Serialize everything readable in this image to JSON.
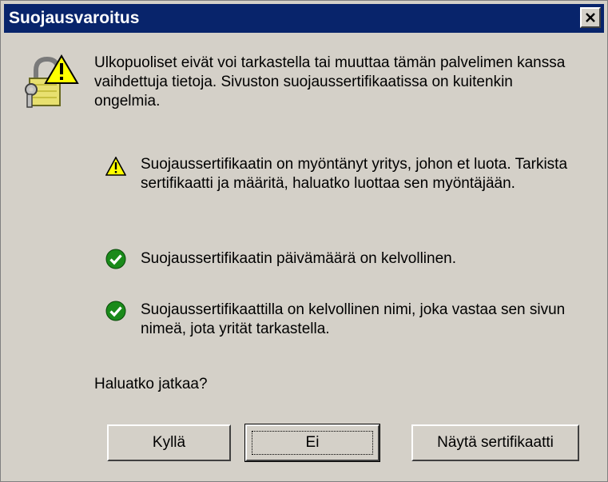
{
  "dialog": {
    "title": "Suojausvaroitus",
    "close_label": "×"
  },
  "intro_text": "Ulkopuoliset eivät voi tarkastella tai muuttaa tämän palvelimen kanssa vaihdettuja tietoja. Sivuston suojaussertifikaatissa on kuitenkin ongelmia.",
  "checks": [
    {
      "status": "warning",
      "icon": "warning-triangle-icon",
      "text": "Suojaussertifikaatin on myöntänyt yritys, johon et luota. Tarkista sertifikaatti ja määritä, haluatko luottaa sen myöntäjään."
    },
    {
      "status": "ok",
      "icon": "checkmark-circle-icon",
      "text": "Suojaussertifikaatin päivämäärä on kelvollinen."
    },
    {
      "status": "ok",
      "icon": "checkmark-circle-icon",
      "text": "Suojaussertifikaattilla on kelvollinen nimi, joka vastaa sen sivun nimeä, jota yrität tarkastella."
    }
  ],
  "question": "Haluatko jatkaa?",
  "buttons": {
    "yes_label": "Kyllä",
    "no_label": "Ei",
    "view_cert_label": "Näytä sertifikaatti"
  },
  "colors": {
    "titlebar": "#08246b",
    "dialog_bg": "#d4d0c8",
    "warning_yellow": "#ffff00",
    "ok_green": "#1a8a1a"
  }
}
